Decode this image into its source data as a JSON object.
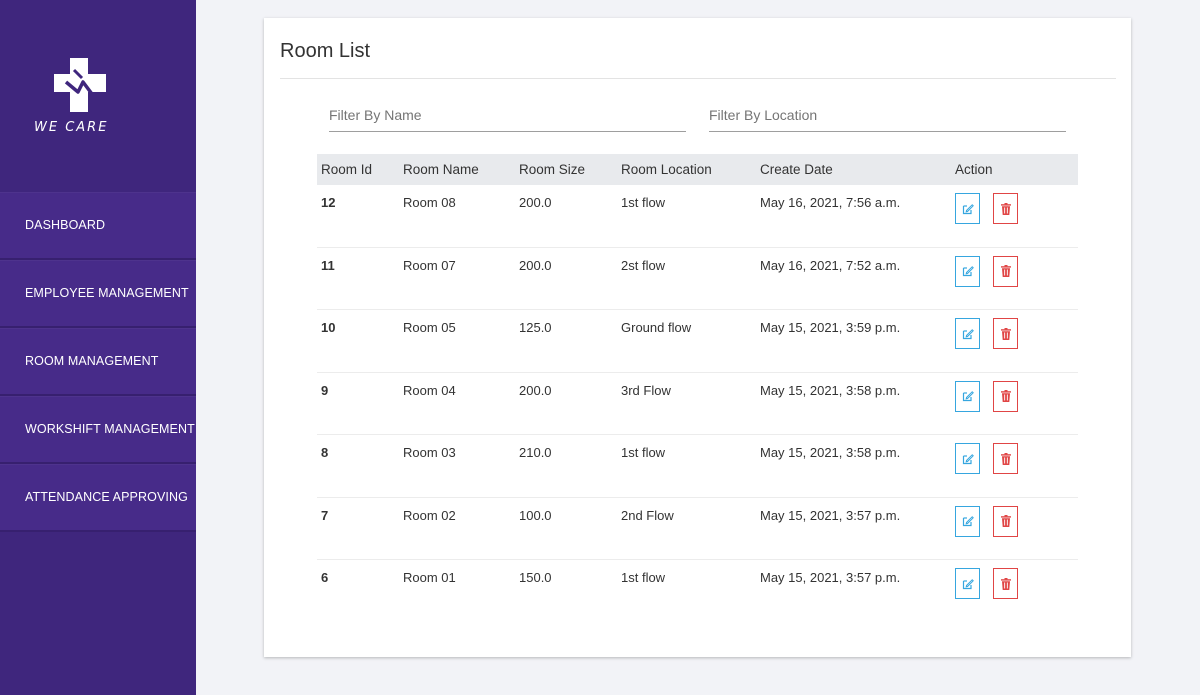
{
  "app": {
    "brand": "WE CARE"
  },
  "sidebar": {
    "items": [
      {
        "label": "DASHBOARD"
      },
      {
        "label": "EMPLOYEE MANAGEMENT"
      },
      {
        "label": "ROOM MANAGEMENT"
      },
      {
        "label": "WORKSHIFT MANAGEMENT"
      },
      {
        "label": "ATTENDANCE APPROVING"
      }
    ]
  },
  "main": {
    "title": "Room List",
    "filters": {
      "name_placeholder": "Filter By Name",
      "location_placeholder": "Filter By Location"
    },
    "table": {
      "headers": {
        "id": "Room Id",
        "name": "Room Name",
        "size": "Room Size",
        "location": "Room Location",
        "date": "Create Date",
        "action": "Action"
      },
      "rows": [
        {
          "id": "12",
          "name": "Room 08",
          "size": "200.0",
          "location": "1st flow",
          "date": "May 16, 2021, 7:56 a.m."
        },
        {
          "id": "11",
          "name": "Room 07",
          "size": "200.0",
          "location": "2st flow",
          "date": "May 16, 2021, 7:52 a.m."
        },
        {
          "id": "10",
          "name": "Room 05",
          "size": "125.0",
          "location": "Ground flow",
          "date": "May 15, 2021, 3:59 p.m."
        },
        {
          "id": "9",
          "name": "Room 04",
          "size": "200.0",
          "location": "3rd Flow",
          "date": "May 15, 2021, 3:58 p.m."
        },
        {
          "id": "8",
          "name": "Room 03",
          "size": "210.0",
          "location": "1st flow",
          "date": "May 15, 2021, 3:58 p.m."
        },
        {
          "id": "7",
          "name": "Room 02",
          "size": "100.0",
          "location": "2nd Flow",
          "date": "May 15, 2021, 3:57 p.m."
        },
        {
          "id": "6",
          "name": "Room 01",
          "size": "150.0",
          "location": "1st flow",
          "date": "May 15, 2021, 3:57 p.m."
        }
      ]
    }
  },
  "colors": {
    "sidebar_bg": "#3f267d",
    "nav_item_bg": "#472b89",
    "page_bg": "#f2f3f7",
    "edit_accent": "#36a6df",
    "delete_accent": "#e04545",
    "header_row_bg": "#e8eaed"
  },
  "icons": {
    "logo": "medical-cross-logo",
    "edit": "edit-icon",
    "delete": "trash-icon"
  }
}
